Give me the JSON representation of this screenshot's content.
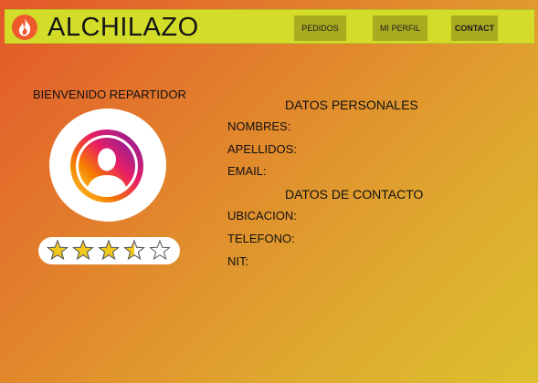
{
  "header": {
    "brand": "ALCHILAZO",
    "nav": {
      "pedidos": "PEDIDOS",
      "perfil": "MI PERFIL",
      "contact": "CONTACT"
    }
  },
  "profile": {
    "welcome": "BIENVENIDO REPARTIDOR",
    "rating": 3.5,
    "rating_max": 5
  },
  "personal": {
    "title": "DATOS PERSONALES",
    "nombres": "NOMBRES:",
    "apellidos": "APELLIDOS:",
    "email": "EMAIL:"
  },
  "contact": {
    "title": "DATOS DE CONTACTO",
    "ubicacion": "UBICACION:",
    "telefono": "TELEFONO:",
    "nit": "NIT:"
  },
  "colors": {
    "topbar": "#d4dc2a",
    "nav_button": "#a9ab20",
    "star_fill": "#f2c81f",
    "logo": "#ef5a2c",
    "background_start": "#e4572a",
    "background_end": "#dcc12f"
  },
  "icons": [
    "fire-logo-icon",
    "user-avatar-icon",
    "star-icon"
  ]
}
